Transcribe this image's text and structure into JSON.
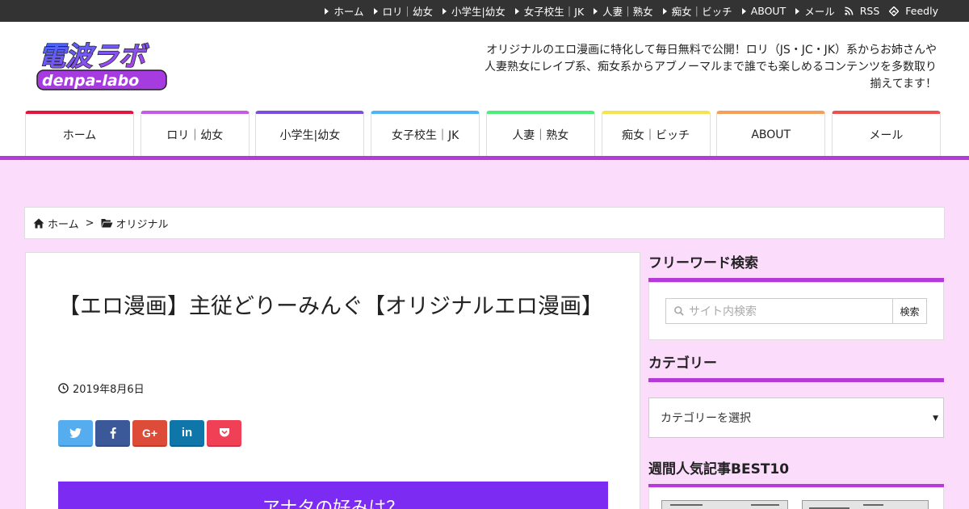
{
  "topbar": {
    "items": [
      {
        "label": "ホーム",
        "icon": "triangle-right-icon"
      },
      {
        "label": "ロリ｜幼女",
        "icon": "triangle-right-icon"
      },
      {
        "label": "小学生|幼女",
        "icon": "triangle-right-icon"
      },
      {
        "label": "女子校生｜JK",
        "icon": "triangle-right-icon"
      },
      {
        "label": "人妻｜熟女",
        "icon": "triangle-right-icon"
      },
      {
        "label": "痴女｜ビッチ",
        "icon": "triangle-right-icon"
      },
      {
        "label": "ABOUT",
        "icon": "triangle-right-icon"
      },
      {
        "label": "メール",
        "icon": "triangle-right-icon"
      },
      {
        "label": "RSS",
        "icon": "rss-icon"
      },
      {
        "label": "Feedly",
        "icon": "feedly-icon"
      }
    ]
  },
  "header": {
    "logo_text_top": "電波ラボ",
    "logo_text_bottom": "denpa-labo",
    "tagline": "オリジナルのエロ漫画に特化して毎日無料で公開！ロリ（JS・JC・JK）系からお姉さんや人妻熟女にレイプ系、痴女系からアブノーマルまで誰でも楽しめるコンテンツを多数取り揃えてます！"
  },
  "nav": {
    "items": [
      {
        "label": "ホーム",
        "color": "#e0163f"
      },
      {
        "label": "ロリ｜幼女",
        "color": "#c45be6"
      },
      {
        "label": "小学生|幼女",
        "color": "#7a4fe0"
      },
      {
        "label": "女子校生｜JK",
        "color": "#4fb4f2"
      },
      {
        "label": "人妻｜熟女",
        "color": "#4ded7a"
      },
      {
        "label": "痴女｜ビッチ",
        "color": "#f5e451"
      },
      {
        "label": "ABOUT",
        "color": "#f5a05a"
      },
      {
        "label": "メール",
        "color": "#ee4f4f"
      }
    ],
    "underline_color": "#b63ad8"
  },
  "breadcrumb": {
    "home": "ホーム",
    "separator": ">",
    "category": "オリジナル"
  },
  "article": {
    "title": "【エロ漫画】主従どりーみんぐ【オリジナルエロ漫画】",
    "date": "2019年8月6日",
    "share_buttons": [
      {
        "name": "twitter",
        "icon": "twitter-icon",
        "color": "#55acee"
      },
      {
        "name": "facebook",
        "icon": "facebook-icon",
        "color": "#3b5998"
      },
      {
        "name": "google-plus",
        "icon": "google-plus-icon",
        "color": "#dd4b39"
      },
      {
        "name": "linkedin",
        "icon": "linkedin-icon",
        "color": "#0e76a8"
      },
      {
        "name": "pocket",
        "icon": "pocket-icon",
        "color": "#ef4056"
      }
    ],
    "banner_text": "アナタの好みは？",
    "banner_color": "#7c2cf2"
  },
  "sidebar": {
    "search_title": "フリーワード検索",
    "search_placeholder": "サイト内検索",
    "search_button": "検索",
    "category_title": "カテゴリー",
    "category_select": "カテゴリーを選択",
    "popular_title": "週間人気記事BEST10"
  }
}
